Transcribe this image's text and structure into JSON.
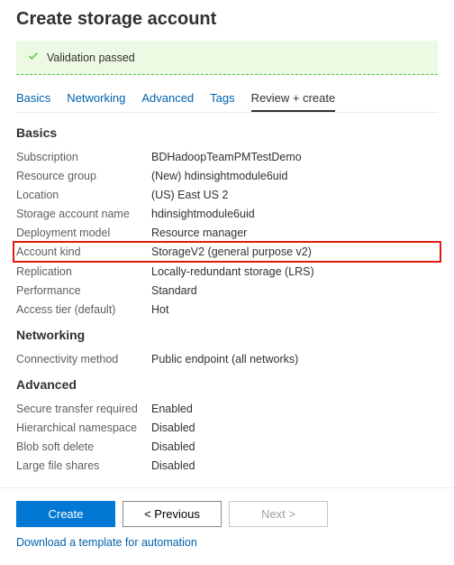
{
  "header": {
    "title": "Create storage account"
  },
  "validation": {
    "message": "Validation passed"
  },
  "tabs": [
    {
      "label": "Basics"
    },
    {
      "label": "Networking"
    },
    {
      "label": "Advanced"
    },
    {
      "label": "Tags"
    },
    {
      "label": "Review + create"
    }
  ],
  "sections": {
    "basics": {
      "title": "Basics",
      "rows": {
        "subscription": {
          "label": "Subscription",
          "value": "BDHadoopTeamPMTestDemo"
        },
        "resource_group": {
          "label": "Resource group",
          "value": "(New) hdinsightmodule6uid"
        },
        "location": {
          "label": "Location",
          "value": "(US) East US 2"
        },
        "storage_account_name": {
          "label": "Storage account name",
          "value": "hdinsightmodule6uid"
        },
        "deployment_model": {
          "label": "Deployment model",
          "value": "Resource manager"
        },
        "account_kind": {
          "label": "Account kind",
          "value": "StorageV2 (general purpose v2)"
        },
        "replication": {
          "label": "Replication",
          "value": "Locally-redundant storage (LRS)"
        },
        "performance": {
          "label": "Performance",
          "value": "Standard"
        },
        "access_tier": {
          "label": "Access tier (default)",
          "value": "Hot"
        }
      }
    },
    "networking": {
      "title": "Networking",
      "rows": {
        "connectivity": {
          "label": "Connectivity method",
          "value": "Public endpoint (all networks)"
        }
      }
    },
    "advanced": {
      "title": "Advanced",
      "rows": {
        "secure_transfer": {
          "label": "Secure transfer required",
          "value": "Enabled"
        },
        "hierarchical_namespace": {
          "label": "Hierarchical namespace",
          "value": "Disabled"
        },
        "blob_soft_delete": {
          "label": "Blob soft delete",
          "value": "Disabled"
        },
        "large_file_shares": {
          "label": "Large file shares",
          "value": "Disabled"
        }
      }
    }
  },
  "actions": {
    "create": "Create",
    "previous": "< Previous",
    "next": "Next >",
    "download": "Download a template for automation"
  }
}
